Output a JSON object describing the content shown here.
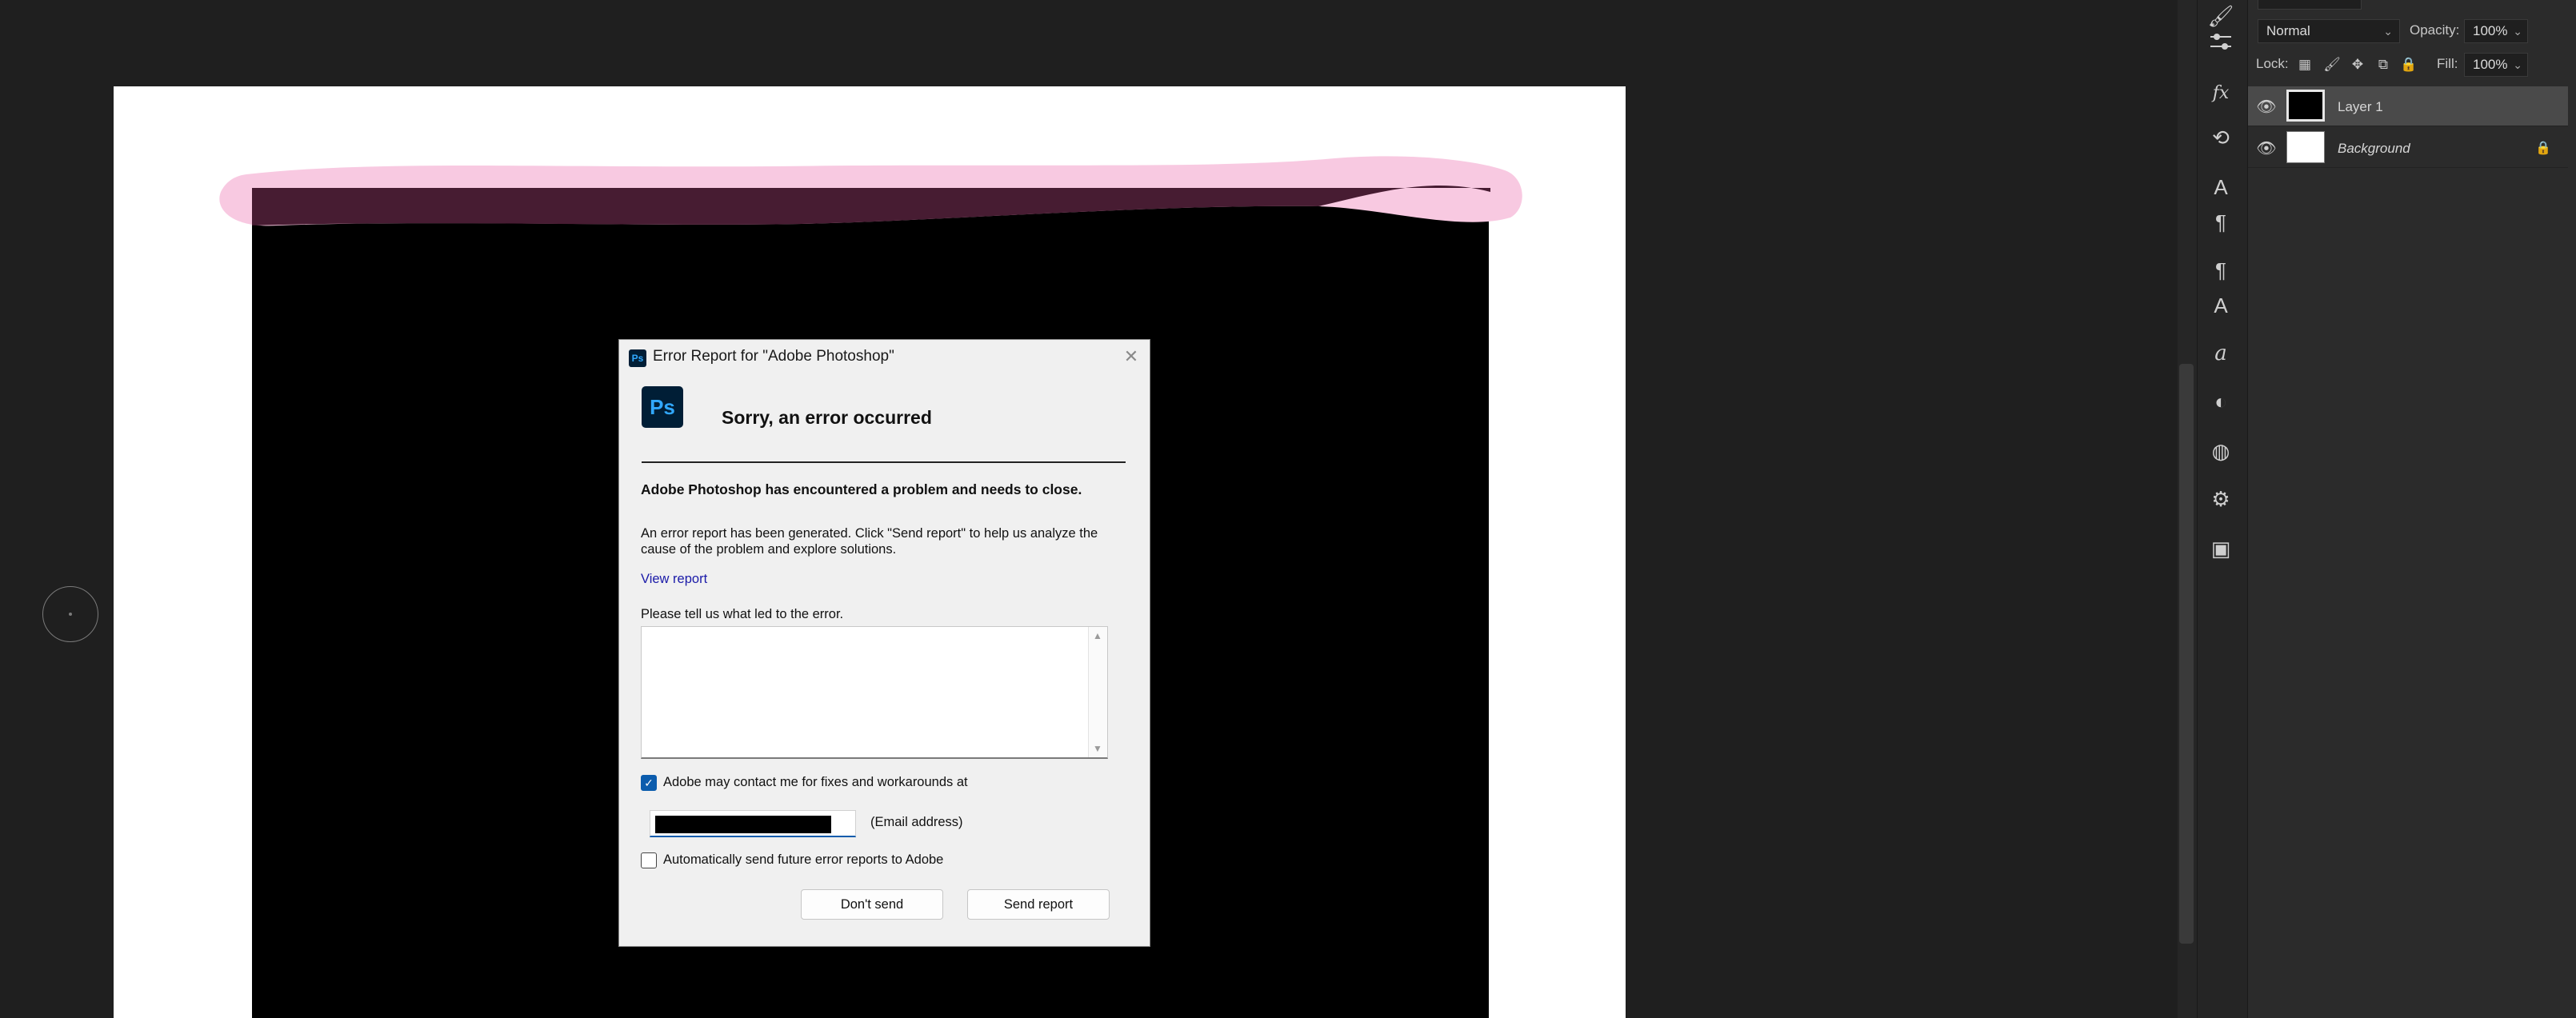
{
  "dialog": {
    "title": "Error Report for \"Adobe Photoshop\"",
    "close_glyph": "✕",
    "app_icon_text": "Ps",
    "heading": "Sorry, an error occurred",
    "problem_text": "Adobe Photoshop has encountered a problem and needs to close.",
    "body_text": "An error report has been generated. Click \"Send report\" to help us analyze the cause of the problem and explore solutions.",
    "view_report_link": "View report",
    "prompt_label": "Please tell us what led to the error.",
    "comment_value": "",
    "contact_checkbox_checked": true,
    "contact_label": "Adobe may contact me for fixes and workarounds at",
    "email_label": "(Email address)",
    "auto_send_checked": false,
    "auto_send_label": "Automatically send future error reports to Adobe",
    "dont_send_button": "Don't send",
    "send_report_button": "Send report",
    "link_color": "#1a1aa8",
    "accent_color": "#0b5cad"
  },
  "layers_panel": {
    "blend_mode": "Normal",
    "opacity_label": "Opacity:",
    "opacity_value": "100%",
    "lock_label": "Lock:",
    "fill_label": "Fill:",
    "fill_value": "100%",
    "layers": [
      {
        "name": "Layer 1",
        "visible": true,
        "selected": true,
        "thumbnail": "black"
      },
      {
        "name": "Background",
        "visible": true,
        "selected": false,
        "locked": true,
        "thumbnail": "white"
      }
    ]
  },
  "toolbar": {
    "icons": [
      "brush-icon",
      "adjustments-icon",
      "fx-icon",
      "rotate-icon",
      "character-icon",
      "paragraph-icon",
      "paragraph-styles-icon",
      "character-styles-icon",
      "glyphs-icon",
      "color-icon",
      "swatches-icon",
      "properties-icon",
      "libraries-icon"
    ],
    "fx_label": "fx"
  },
  "canvas": {
    "background": "#ffffff",
    "layer_color": "#000000",
    "stroke_color": "#f7c6df"
  }
}
